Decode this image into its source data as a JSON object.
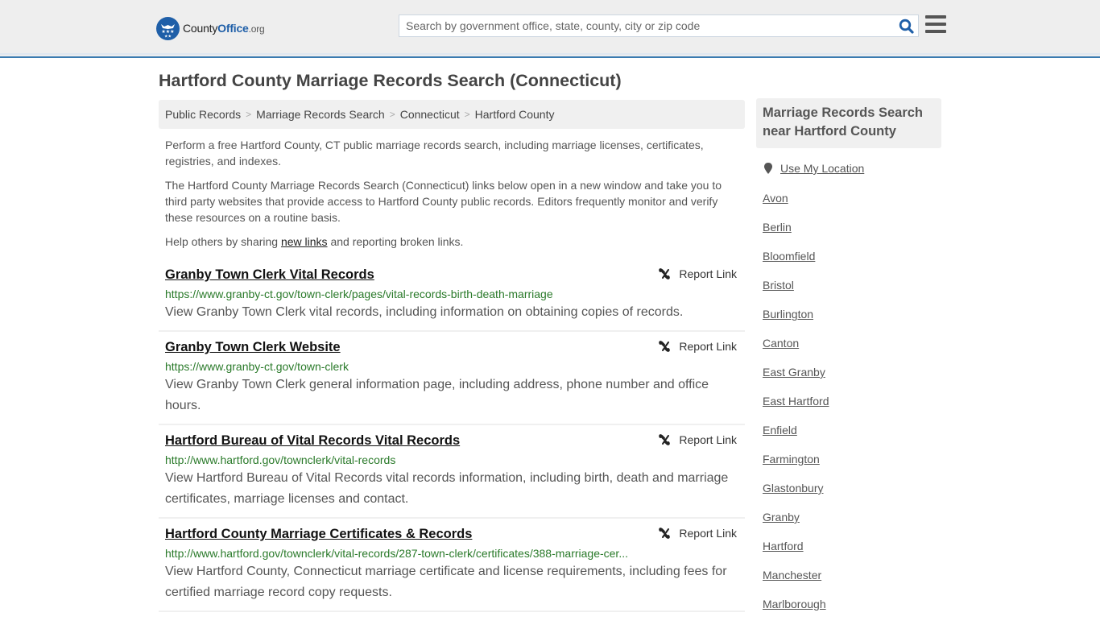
{
  "header": {
    "logo": {
      "county": "County",
      "office": "Office",
      "tld": ".org"
    },
    "search": {
      "placeholder": "Search by government office, state, county, city or zip code",
      "value": ""
    },
    "icons": {
      "search": "search-icon",
      "menu": "hamburger-menu-icon"
    }
  },
  "page_title": "Hartford County Marriage Records Search (Connecticut)",
  "breadcrumb": [
    "Public Records",
    "Marriage Records Search",
    "Connecticut",
    "Hartford County"
  ],
  "intro": {
    "p1": "Perform a free Hartford County, CT public marriage records search, including marriage licenses, certificates, registries, and indexes.",
    "p2": "The Hartford County Marriage Records Search (Connecticut) links below open in a new window and take you to third party websites that provide access to Hartford County public records. Editors frequently monitor and verify these resources on a routine basis.",
    "p3_before": "Help others by sharing ",
    "p3_link": "new links",
    "p3_after": " and reporting broken links."
  },
  "report_label": "Report Link",
  "results": [
    {
      "title": "Granby Town Clerk Vital Records",
      "url": "https://www.granby-ct.gov/town-clerk/pages/vital-records-birth-death-marriage",
      "description": "View Granby Town Clerk vital records, including information on obtaining copies of records."
    },
    {
      "title": "Granby Town Clerk Website",
      "url": "https://www.granby-ct.gov/town-clerk",
      "description": "View Granby Town Clerk general information page, including address, phone number and office hours."
    },
    {
      "title": "Hartford Bureau of Vital Records Vital Records",
      "url": "http://www.hartford.gov/townclerk/vital-records",
      "description": "View Hartford Bureau of Vital Records vital records information, including birth, death and marriage certificates, marriage licenses and contact."
    },
    {
      "title": "Hartford County Marriage Certificates & Records",
      "url": "http://www.hartford.gov/townclerk/vital-records/287-town-clerk/certificates/388-marriage-cer...",
      "description": "View Hartford County, Connecticut marriage certificate and license requirements, including fees for certified marriage record copy requests."
    }
  ],
  "sidebar": {
    "title": "Marriage Records Search near Hartford County",
    "use_location": "Use My Location",
    "towns": [
      "Avon",
      "Berlin",
      "Bloomfield",
      "Bristol",
      "Burlington",
      "Canton",
      "East Granby",
      "East Hartford",
      "Enfield",
      "Farmington",
      "Glastonbury",
      "Granby",
      "Hartford",
      "Manchester",
      "Marlborough"
    ]
  }
}
